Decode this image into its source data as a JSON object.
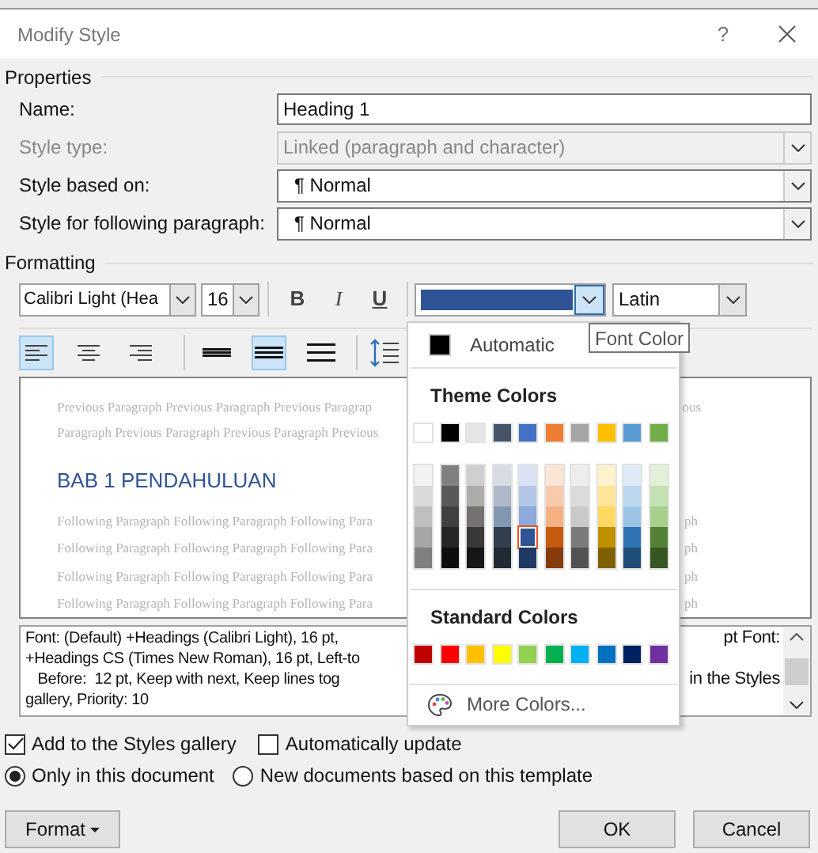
{
  "window": {
    "title": "Modify Style",
    "help": "?"
  },
  "properties": {
    "heading": "Properties",
    "fields": [
      {
        "label": "Name:",
        "value": "Heading 1",
        "kind": "text",
        "disabled": false
      },
      {
        "label": "Style type:",
        "value": "Linked (paragraph and character)",
        "kind": "dropdown",
        "disabled": true
      },
      {
        "label": "Style based on:",
        "value": "¶ Normal",
        "kind": "dropdown",
        "disabled": false
      },
      {
        "label": "Style for following paragraph:",
        "value": "¶ Normal",
        "kind": "dropdown",
        "disabled": false
      }
    ]
  },
  "formatting": {
    "heading": "Formatting",
    "font": "Calibri Light (Hea",
    "size": "16",
    "styles": [
      {
        "label": "B",
        "kind": "bold",
        "selected": false
      },
      {
        "label": "I",
        "kind": "italic",
        "selected": false
      },
      {
        "label": "U",
        "kind": "underline",
        "selected": false
      }
    ],
    "color": "#2f5496",
    "script": "Latin",
    "alignment": [
      {
        "kind": "left",
        "selected": true
      },
      {
        "kind": "center",
        "selected": false
      },
      {
        "kind": "right",
        "selected": false
      }
    ],
    "spacing": [
      {
        "kind": "single",
        "selected": false
      },
      {
        "kind": "one-half",
        "selected": true
      },
      {
        "kind": "double",
        "selected": false
      }
    ]
  },
  "preview": {
    "before": [
      {
        "left": "Previous Paragraph Previous Paragraph Previous Paragrap",
        "right": "ous"
      },
      {
        "left": "Paragraph Previous Paragraph Previous Paragraph Previous"
      }
    ],
    "heading": "BAB 1 PENDAHULUAN",
    "after": [
      {
        "left": "Following Paragraph Following Paragraph Following Para",
        "right": "ph"
      },
      {
        "left": "Following Paragraph Following Paragraph Following Para",
        "right": "ph"
      },
      {
        "left": "Following Paragraph Following Paragraph Following Para",
        "right": "ph"
      },
      {
        "left": "Following Paragraph Following Paragraph Following Para",
        "right": "ph"
      }
    ]
  },
  "description": [
    {
      "left": "Font: (Default) +Headings (Calibri Light), 16 pt,",
      "right": "pt Font:"
    },
    {
      "left": "+Headings CS (Times New Roman), 16 pt, Left-to"
    },
    {
      "left": "   Before:  12 pt, Keep with next, Keep lines tog",
      "right": "in the Styles"
    },
    {
      "left": "gallery, Priority: 10"
    }
  ],
  "options": {
    "checkboxes": [
      {
        "label": "Add to the Styles gallery",
        "checked": true
      },
      {
        "label": "Automatically update",
        "checked": false
      }
    ],
    "radios": [
      {
        "label": "Only in this document",
        "selected": true
      },
      {
        "label": "New documents based on this template",
        "selected": false
      }
    ]
  },
  "buttons": {
    "format": "Format",
    "ok": "OK",
    "cancel": "Cancel"
  },
  "tooltip": "Font Color",
  "color_menu": {
    "automatic": "Automatic",
    "theme_heading": "Theme Colors",
    "theme_colors": [
      {
        "color": "#ffffff",
        "shades": [
          {
            "color": "#f2f2f2",
            "selected": false
          },
          {
            "color": "#d9d9d9",
            "selected": false
          },
          {
            "color": "#bfbfbf",
            "selected": false
          },
          {
            "color": "#a6a6a6",
            "selected": false
          },
          {
            "color": "#808080",
            "selected": false
          }
        ]
      },
      {
        "color": "#000000",
        "shades": [
          {
            "color": "#808080",
            "selected": false
          },
          {
            "color": "#595959",
            "selected": false
          },
          {
            "color": "#404040",
            "selected": false
          },
          {
            "color": "#262626",
            "selected": false
          },
          {
            "color": "#0d0d0d",
            "selected": false
          }
        ]
      },
      {
        "color": "#e7e6e6",
        "shades": [
          {
            "color": "#d0cece",
            "selected": false
          },
          {
            "color": "#aeabab",
            "selected": false
          },
          {
            "color": "#757171",
            "selected": false
          },
          {
            "color": "#3a3838",
            "selected": false
          },
          {
            "color": "#171616",
            "selected": false
          }
        ]
      },
      {
        "color": "#44546a",
        "shades": [
          {
            "color": "#d6dce4",
            "selected": false
          },
          {
            "color": "#adb9ca",
            "selected": false
          },
          {
            "color": "#8497b0",
            "selected": false
          },
          {
            "color": "#333f4f",
            "selected": false
          },
          {
            "color": "#222a35",
            "selected": false
          }
        ]
      },
      {
        "color": "#4472c4",
        "shades": [
          {
            "color": "#d9e2f3",
            "selected": false
          },
          {
            "color": "#b4c6e7",
            "selected": false
          },
          {
            "color": "#8eaadb",
            "selected": false
          },
          {
            "color": "#2f5496",
            "selected": true
          },
          {
            "color": "#1f3864",
            "selected": false
          }
        ]
      },
      {
        "color": "#ed7d31",
        "shades": [
          {
            "color": "#fbe5d5",
            "selected": false
          },
          {
            "color": "#f7cbac",
            "selected": false
          },
          {
            "color": "#f4b183",
            "selected": false
          },
          {
            "color": "#c55a11",
            "selected": false
          },
          {
            "color": "#843c0b",
            "selected": false
          }
        ]
      },
      {
        "color": "#a5a5a5",
        "shades": [
          {
            "color": "#ededed",
            "selected": false
          },
          {
            "color": "#dbdbdb",
            "selected": false
          },
          {
            "color": "#c9c9c9",
            "selected": false
          },
          {
            "color": "#7b7b7b",
            "selected": false
          },
          {
            "color": "#525252",
            "selected": false
          }
        ]
      },
      {
        "color": "#ffc000",
        "shades": [
          {
            "color": "#fff2cc",
            "selected": false
          },
          {
            "color": "#fee599",
            "selected": false
          },
          {
            "color": "#ffd966",
            "selected": false
          },
          {
            "color": "#bf9000",
            "selected": false
          },
          {
            "color": "#7f6000",
            "selected": false
          }
        ]
      },
      {
        "color": "#5b9bd5",
        "shades": [
          {
            "color": "#deeaf6",
            "selected": false
          },
          {
            "color": "#bdd7ee",
            "selected": false
          },
          {
            "color": "#9dc3e6",
            "selected": false
          },
          {
            "color": "#2e75b5",
            "selected": false
          },
          {
            "color": "#1e4e79",
            "selected": false
          }
        ]
      },
      {
        "color": "#70ad47",
        "shades": [
          {
            "color": "#e2efd9",
            "selected": false
          },
          {
            "color": "#c5e0b3",
            "selected": false
          },
          {
            "color": "#a8d08d",
            "selected": false
          },
          {
            "color": "#538135",
            "selected": false
          },
          {
            "color": "#375623",
            "selected": false
          }
        ]
      }
    ],
    "standard_heading": "Standard Colors",
    "standard_colors": [
      {
        "color": "#c00000"
      },
      {
        "color": "#ff0000"
      },
      {
        "color": "#ffc000"
      },
      {
        "color": "#ffff00"
      },
      {
        "color": "#92d050"
      },
      {
        "color": "#00b050"
      },
      {
        "color": "#00b0f0"
      },
      {
        "color": "#0070c0"
      },
      {
        "color": "#002060"
      },
      {
        "color": "#7030a0"
      }
    ],
    "more": "More Colors..."
  }
}
